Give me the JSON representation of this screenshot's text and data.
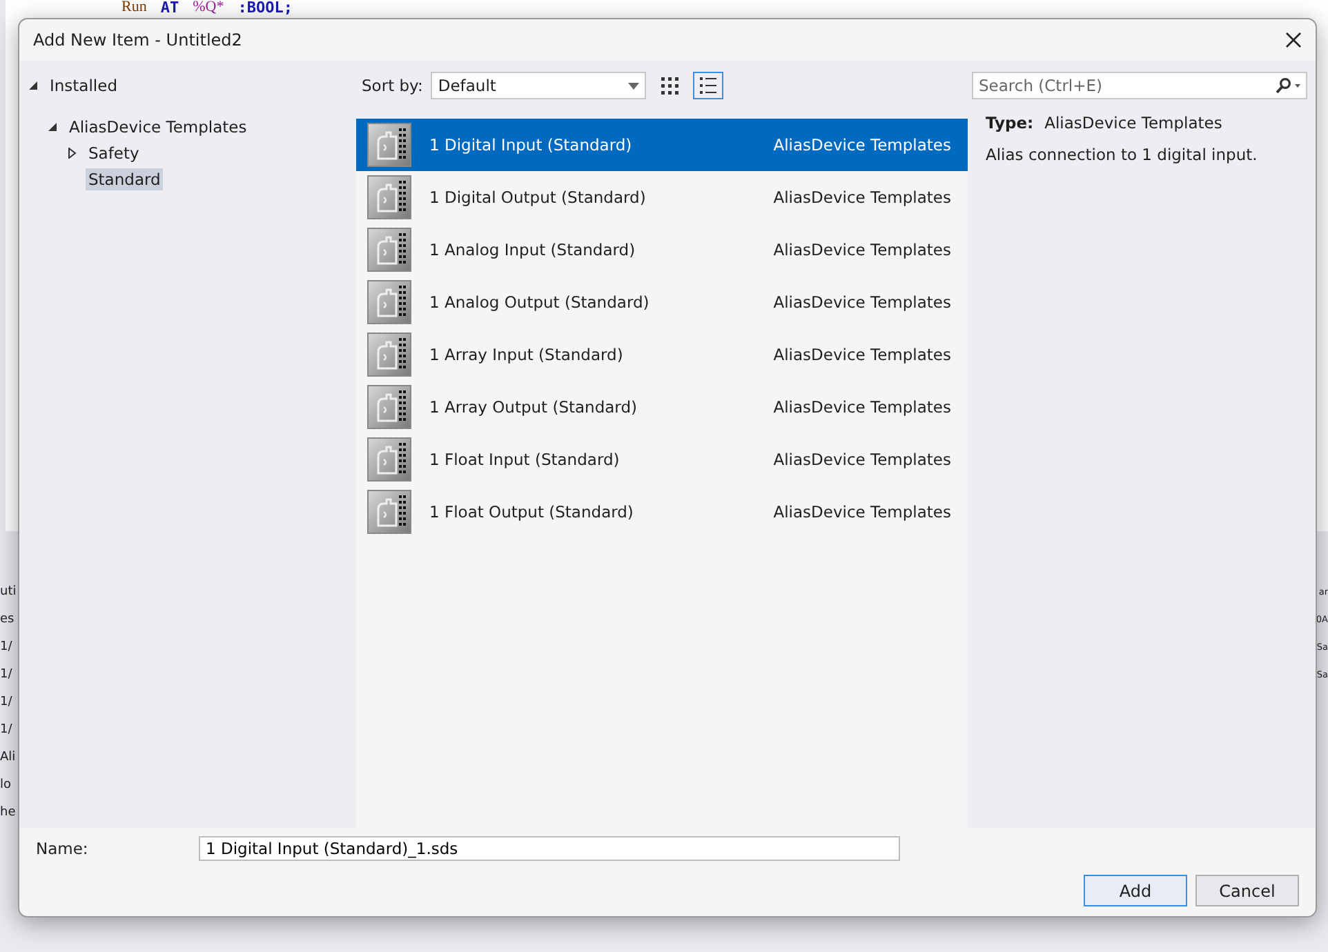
{
  "background": {
    "code_line": [
      {
        "text": "Run",
        "kind": "ident"
      },
      {
        "text": "AT",
        "kind": "keyword"
      },
      {
        "text": "%Q*",
        "kind": "address"
      },
      {
        "text": ":BOOL;",
        "kind": "keyword"
      }
    ],
    "left_fragments": [
      "uti",
      "es",
      "1/",
      "1/",
      "1/",
      "1/",
      "Ali",
      "lo",
      "he"
    ],
    "right_fragments": [
      "ar",
      "0A",
      "Sa",
      "Sa"
    ]
  },
  "window": {
    "title": "Add New Item - Untitled2"
  },
  "tree": [
    {
      "label": "Installed",
      "expanded": true,
      "selected": false,
      "children": [
        {
          "label": "AliasDevice Templates",
          "expanded": true,
          "selected": false,
          "children": [
            {
              "label": "Safety",
              "expanded": false,
              "selected": false
            },
            {
              "label": "Standard",
              "selected": true
            }
          ]
        }
      ]
    }
  ],
  "sort": {
    "label": "Sort by:",
    "value": "Default"
  },
  "views": [
    {
      "kind": "grid",
      "selected": false
    },
    {
      "kind": "list",
      "selected": true
    }
  ],
  "search": {
    "placeholder": "Search (Ctrl+E)"
  },
  "items": [
    {
      "name": "1 Digital Input (Standard)",
      "category": "AliasDevice Templates",
      "selected": true
    },
    {
      "name": "1 Digital Output (Standard)",
      "category": "AliasDevice Templates",
      "selected": false
    },
    {
      "name": "1 Analog Input (Standard)",
      "category": "AliasDevice Templates",
      "selected": false
    },
    {
      "name": "1 Analog Output (Standard)",
      "category": "AliasDevice Templates",
      "selected": false
    },
    {
      "name": "1 Array Input (Standard)",
      "category": "AliasDevice Templates",
      "selected": false
    },
    {
      "name": "1 Array Output (Standard)",
      "category": "AliasDevice Templates",
      "selected": false
    },
    {
      "name": "1 Float Input (Standard)",
      "category": "AliasDevice Templates",
      "selected": false
    },
    {
      "name": "1 Float Output (Standard)",
      "category": "AliasDevice Templates",
      "selected": false
    }
  ],
  "details": {
    "type_label": "Type:",
    "type_value": "AliasDevice Templates",
    "description": "Alias connection to 1 digital input."
  },
  "name_field": {
    "label": "Name:",
    "value": "1 Digital Input (Standard)_1.sds"
  },
  "buttons": [
    {
      "label": "Add",
      "kind": "default"
    },
    {
      "label": "Cancel",
      "kind": "normal"
    }
  ]
}
